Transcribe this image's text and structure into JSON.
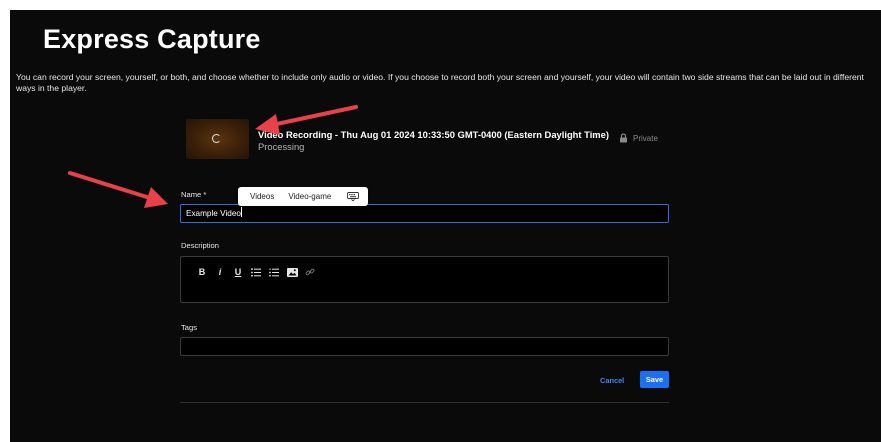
{
  "page": {
    "title": "Express Capture",
    "intro": "You can record your screen, yourself, or both, and choose whether to include only audio or video. If you choose to record both your screen and yourself, your video will contain two side streams that can be laid out in different ways in the player."
  },
  "recording": {
    "title": "Video Recording - Thu Aug 01 2024 10:33:50 GMT-0400 (Eastern Daylight Time)",
    "status": "Processing",
    "privacy": "Private"
  },
  "form": {
    "name_label": "Name *",
    "name_value": "Example Video",
    "description_label": "Description",
    "toolbar": {
      "bold": "B",
      "italic": "i",
      "underline": "U"
    },
    "tags_label": "Tags",
    "tags_value": "",
    "cancel_label": "Cancel",
    "save_label": "Save"
  },
  "suggestions": {
    "items": [
      "Videos",
      "Video-game"
    ]
  },
  "colors": {
    "background": "#0a0a0a",
    "accent": "#1a6ff2",
    "annotation_arrow": "#e8414b"
  },
  "icons": {
    "spinner": "loading-spinner-icon",
    "lock": "lock-icon",
    "bulleted_list": "bulleted-list-icon",
    "numbered_list": "numbered-list-icon",
    "image": "image-icon",
    "link": "link-icon",
    "keyboard": "keyboard-icon"
  }
}
